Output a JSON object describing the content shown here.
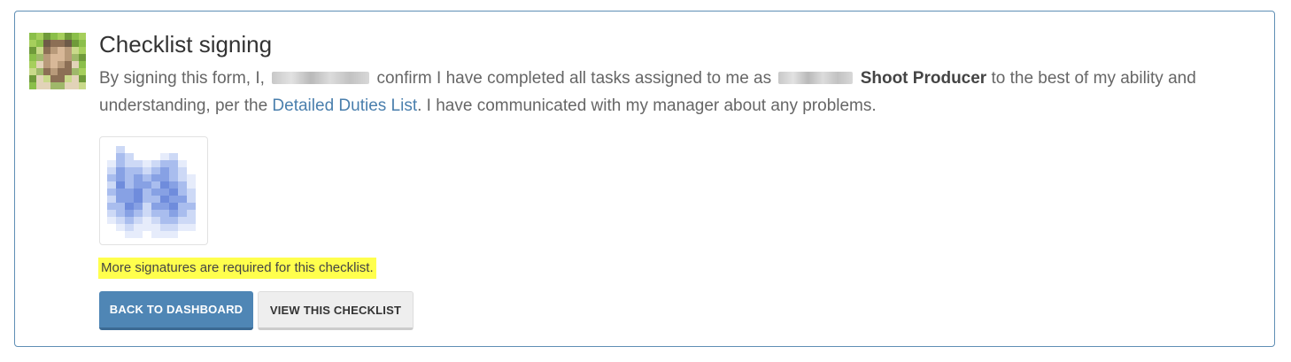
{
  "panel": {
    "title": "Checklist signing",
    "statement": {
      "part1": "By signing this form, I,",
      "part2": "confirm I have completed all tasks assigned to me as",
      "role": "Shoot Producer",
      "part3": "to the best of my ability and understanding, per the",
      "link": "Detailed Duties List",
      "part4": ". I have communicated with my manager about any problems."
    },
    "notice": "More signatures are required for this checklist.",
    "buttons": {
      "back": "BACK TO DASHBOARD",
      "view": "VIEW THIS CHECKLIST"
    }
  },
  "colors": {
    "border": "#5f8fb5",
    "link": "#4a7fad",
    "primary_button": "#4f86b5",
    "highlight": "#ffff4d"
  },
  "icons": {
    "avatar": "user-avatar-pixelated",
    "signature": "signature-image-pixelated"
  }
}
